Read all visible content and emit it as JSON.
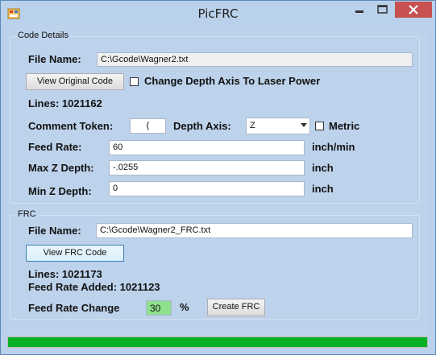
{
  "window": {
    "title": "PicFRC",
    "icons": {
      "app": "app-icon",
      "minimize": "minimize-icon",
      "maximize": "maximize-icon",
      "close": "close-icon"
    }
  },
  "code_details": {
    "group_title": "Code Details",
    "file_name_label": "File Name:",
    "file_name_value": "C:\\Gcode\\Wagner2.txt",
    "view_original_button": "View Original Code",
    "change_depth_checkbox_label": "Change Depth Axis To Laser Power",
    "change_depth_checked": false,
    "lines_text": "Lines: 1021162",
    "comment_token_label": "Comment Token:",
    "comment_token_value": "(",
    "depth_axis_label": "Depth Axis:",
    "depth_axis_value": "Z",
    "metric_label": "Metric",
    "metric_checked": false,
    "feed_rate_label": "Feed Rate:",
    "feed_rate_value": "60",
    "feed_rate_unit": "inch/min",
    "max_z_label": "Max Z Depth:",
    "max_z_value": "-.0255",
    "max_z_unit": "inch",
    "min_z_label": "Min Z Depth:",
    "min_z_value": "0",
    "min_z_unit": "inch"
  },
  "frc": {
    "group_title": "FRC",
    "file_name_label": "File Name:",
    "file_name_value": "C:\\Gcode\\Wagner2_FRC.txt",
    "view_frc_button": "View FRC Code",
    "lines_text": "Lines: 1021173",
    "feed_rate_added_text": "Feed Rate Added: 1021123",
    "feed_rate_change_label": "Feed Rate Change",
    "feed_rate_change_value": "30",
    "percent_label": "%",
    "create_frc_button": "Create FRC"
  },
  "progress": {
    "fraction": 1.0,
    "color": "#06b025"
  },
  "colors": {
    "window_bg": "#bdd2eb",
    "frame": "#b9d1ea",
    "close_button": "#c75050",
    "highlight_field": "#8fe08f"
  }
}
